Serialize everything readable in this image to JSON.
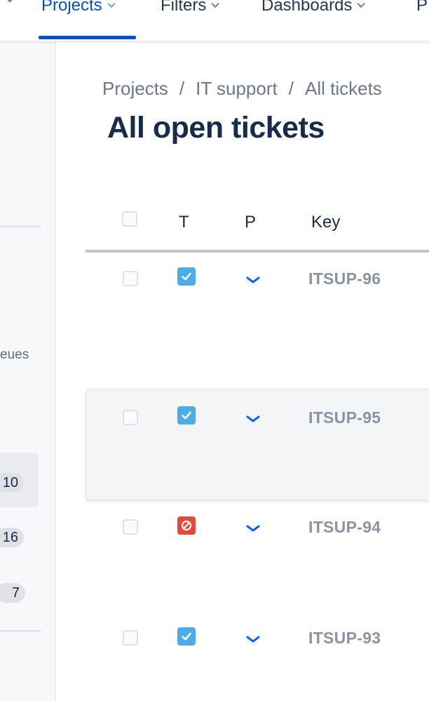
{
  "topnav": {
    "items": [
      {
        "label": "Projects",
        "active": true
      },
      {
        "label": "Filters",
        "active": false
      },
      {
        "label": "Dashboards",
        "active": false
      },
      {
        "label": "P",
        "active": false
      }
    ]
  },
  "sidebar": {
    "queues_label_fragment": "eues",
    "counts": [
      "10",
      "16",
      "7"
    ]
  },
  "breadcrumb": {
    "items": [
      "Projects",
      "IT support",
      "All tickets"
    ],
    "separator": "/"
  },
  "page_title": "All open tickets",
  "table": {
    "headers": {
      "type": "T",
      "priority": "P",
      "key": "Key"
    },
    "rows": [
      {
        "key": "ITSUP-96",
        "type_icon": "task-check-icon",
        "priority_icon": "low-priority-chevron-icon"
      },
      {
        "key": "ITSUP-95",
        "type_icon": "task-check-icon",
        "priority_icon": "low-priority-chevron-icon"
      },
      {
        "key": "ITSUP-94",
        "type_icon": "blocked-icon",
        "priority_icon": "low-priority-chevron-icon"
      },
      {
        "key": "ITSUP-93",
        "type_icon": "task-check-icon",
        "priority_icon": "low-priority-chevron-icon"
      }
    ]
  },
  "colors": {
    "accent": "#0052cc",
    "task_icon": "#4bade8",
    "blocked_icon": "#e5493a",
    "priority_low": "#0065ff",
    "key_text": "#8993a4"
  }
}
